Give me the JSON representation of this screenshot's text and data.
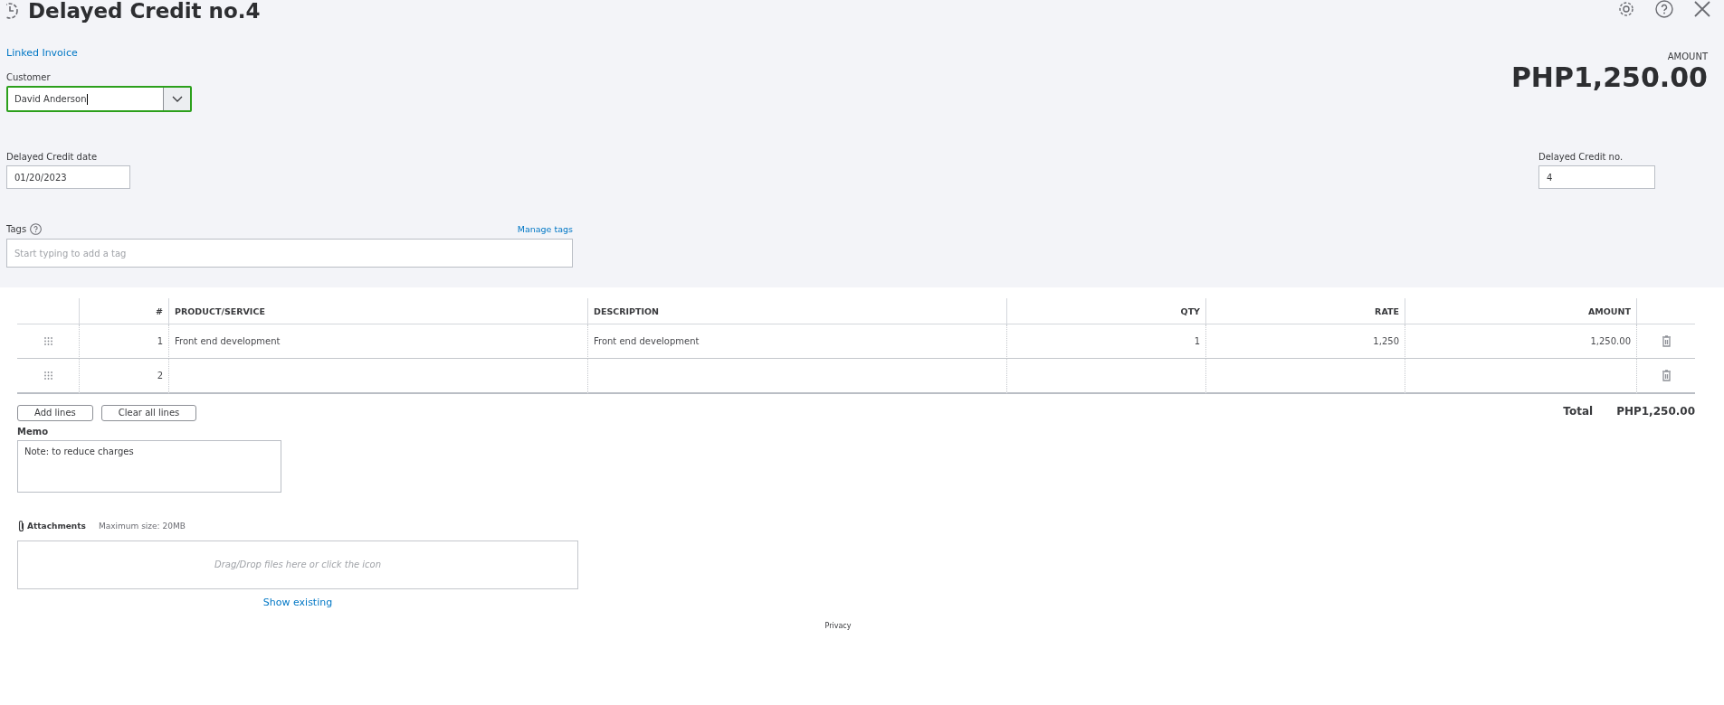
{
  "header": {
    "title": "Delayed Credit no.4",
    "linked_invoice": "Linked Invoice",
    "amount_label": "AMOUNT",
    "amount": "PHP1,250.00"
  },
  "customer": {
    "label": "Customer",
    "value": "David Anderson"
  },
  "date": {
    "label": "Delayed Credit date",
    "value": "01/20/2023"
  },
  "credit_no": {
    "label": "Delayed Credit no.",
    "value": "4"
  },
  "tags": {
    "label": "Tags",
    "manage": "Manage tags",
    "placeholder": "Start typing to add a tag"
  },
  "table": {
    "columns": [
      "#",
      "PRODUCT/SERVICE",
      "DESCRIPTION",
      "QTY",
      "RATE",
      "AMOUNT"
    ],
    "rows": [
      {
        "number": "1",
        "product": "Front end development",
        "description": "Front end development",
        "qty": "1",
        "rate": "1,250",
        "amount": "1,250.00"
      },
      {
        "number": "2",
        "product": "",
        "description": "",
        "qty": "",
        "rate": "",
        "amount": ""
      }
    ]
  },
  "buttons": [
    "Add lines",
    "Clear all lines"
  ],
  "total": {
    "label": "Total",
    "value": "PHP1,250.00"
  },
  "memo": {
    "label": "Memo",
    "value": "Note: to reduce charges"
  },
  "attachments": {
    "label": "Attachments",
    "max_size": "Maximum size: 20MB",
    "drop_hint": "Drag/Drop files here or click the icon",
    "show_existing": "Show existing"
  },
  "footer": {
    "privacy": "Privacy"
  }
}
